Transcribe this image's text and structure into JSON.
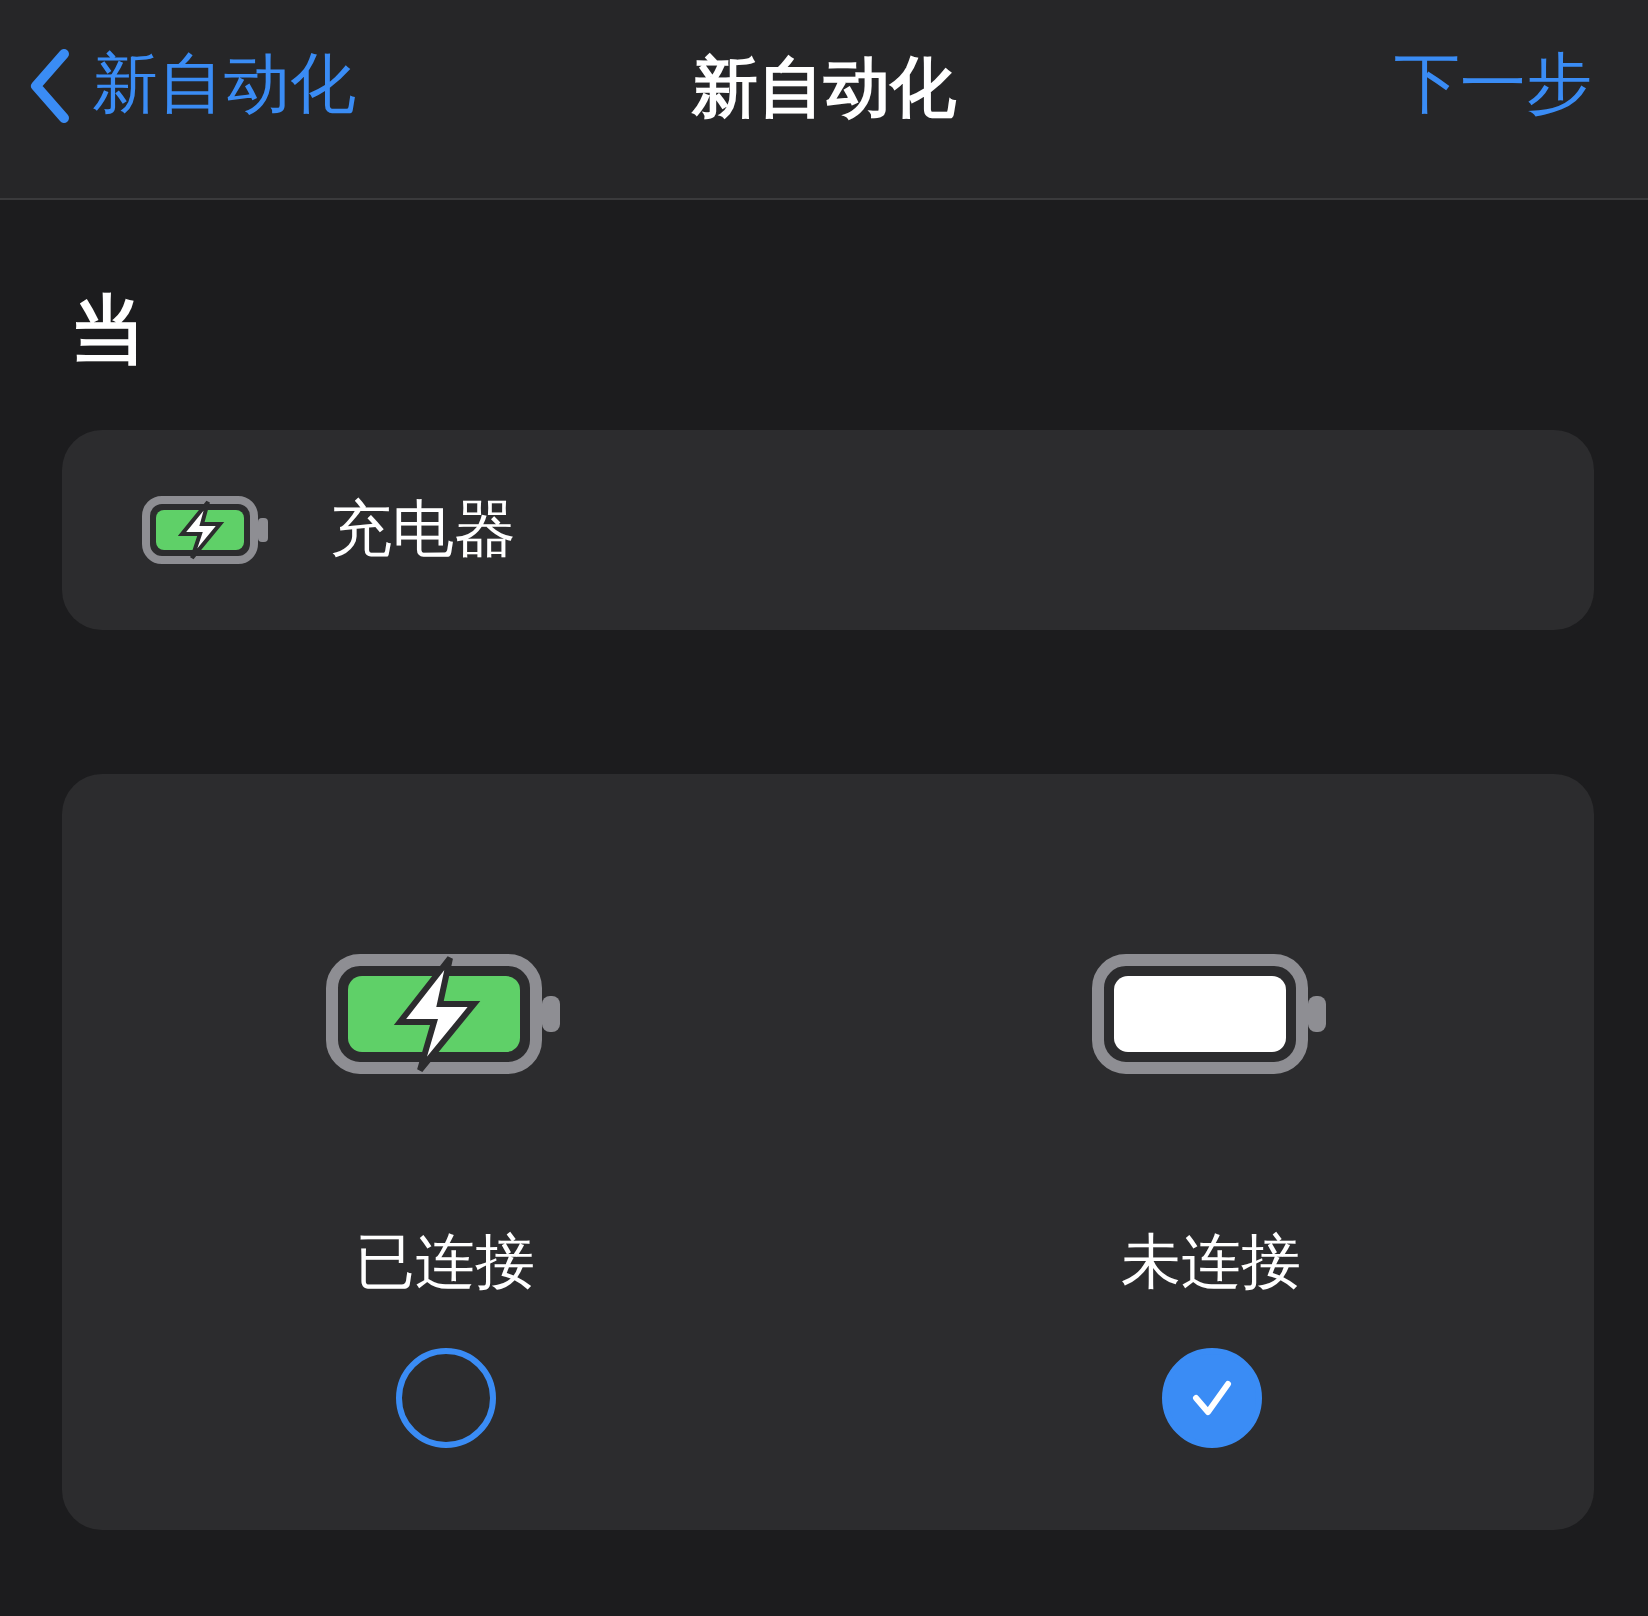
{
  "nav": {
    "back": "新自动化",
    "title": "新自动化",
    "next": "下一步"
  },
  "section_title": "当",
  "trigger": {
    "label": "充电器"
  },
  "options": [
    {
      "label": "已连接",
      "kind": "charging",
      "selected": false
    },
    {
      "label": "未连接",
      "kind": "empty",
      "selected": true
    }
  ]
}
